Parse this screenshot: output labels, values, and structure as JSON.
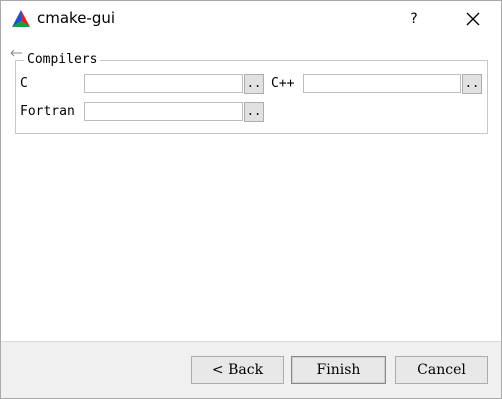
{
  "window": {
    "title": "cmake-gui",
    "help_label": "?"
  },
  "compilers": {
    "group_title": "Compilers",
    "c_label": "C",
    "c_value": "",
    "cxx_label": "C++",
    "cxx_value": "",
    "fortran_label": "Fortran",
    "fortran_value": "",
    "browse_label": ".."
  },
  "buttons": {
    "back_label": "< Back",
    "finish_label": "Finish",
    "cancel_label": "Cancel"
  },
  "colors": {
    "bar_bg": "#f0f0f0",
    "icon_blue": "#1f4fd1",
    "icon_red": "#e02020",
    "icon_green": "#17a03a"
  }
}
